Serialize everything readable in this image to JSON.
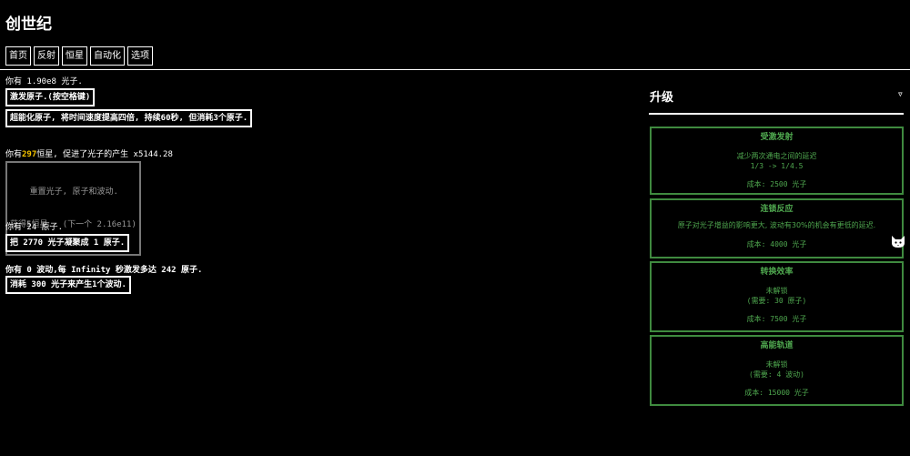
{
  "app": {
    "title": "创世纪"
  },
  "tabs": [
    "首页",
    "反射",
    "恒星",
    "自动化",
    "选项"
  ],
  "photons": {
    "prefix": "你有 ",
    "amount": "1.90e8",
    "suffix": " 光子.",
    "excite_button": "激发原子.(按空格键)",
    "supercharge_button": "超能化原子, 将时间速度提高四倍, 持续60秒, 但消耗3个原子."
  },
  "stars": {
    "prefix": "你有",
    "count": "297",
    "suffix": "恒星, 促进了光子的产生 x5144.28",
    "reset_button_line1": "    重置光子, 原子和波动.",
    "reset_gain_prefix": "获得",
    "reset_gain_count": "5",
    "reset_gain_suffix": "恒星.  (下一个 2.16e11)"
  },
  "atoms": {
    "text": "你有 24 原子.",
    "condense_button": "把 2770 光子凝聚成 1 原子."
  },
  "waves": {
    "text": "你有 0 波动,每 Infinity 秒激发多达 242 原子.",
    "create_button": "消耗 300 光子来产生1个波动."
  },
  "upgrades": {
    "title": "升级",
    "toggle_symbol": "▿",
    "items": [
      {
        "name": "受激发射",
        "line1": "减少两次通电之间的延迟",
        "line2": "1/3 -> 1/4.5",
        "cost": "成本: 2500 光子"
      },
      {
        "name": "连锁反应",
        "line1": "原子对光子增益的影响更大, 波动有30%的机会有更低的延迟.",
        "line2": "",
        "cost": "成本: 4000 光子"
      },
      {
        "name": "转换效率",
        "line1": "未解锁",
        "line2": "(需要: 30 原子)",
        "cost": "成本: 7500 光子"
      },
      {
        "name": "高能轨道",
        "line1": "未解锁",
        "line2": "(需要: 4 波动)",
        "cost": "成本: 15000 光子"
      }
    ]
  },
  "icons": {
    "side_icon": "cat-face-icon",
    "upgrades_toggle": "triangle-down-icon"
  },
  "colors": {
    "background": "#000000",
    "text": "#ffffff",
    "highlight": "#f5c400",
    "upgrade_green": "#4fa84f"
  }
}
